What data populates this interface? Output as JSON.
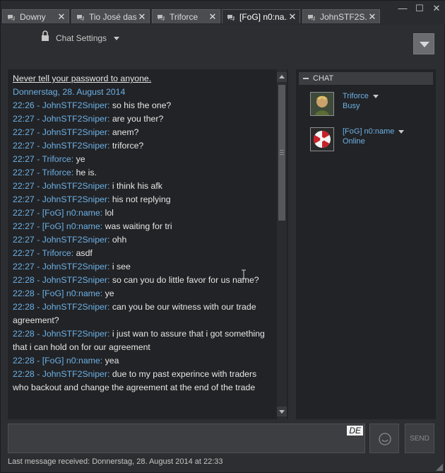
{
  "tabs": [
    {
      "label": "Downy",
      "active": false,
      "icon": "chat-bubbles-icon"
    },
    {
      "label": "Tio José das...",
      "active": false,
      "icon": "chat-bubbles-icon"
    },
    {
      "label": "Triforce",
      "active": false,
      "icon": "chat-bubbles-icon"
    },
    {
      "label": "[FoG] n0:na...",
      "active": true,
      "icon": "chat-bubbles-icon"
    },
    {
      "label": "JohnSTF2S...",
      "active": false,
      "icon": "chat-bubbles-icon"
    }
  ],
  "window_controls": {
    "minimize": "—",
    "maximize": "☐",
    "close": "✕"
  },
  "tab_close": "✕",
  "header": {
    "chat_settings_label": "Chat Settings"
  },
  "chat": {
    "warning": "Never tell your password to anyone.",
    "date": "Donnerstag, 28. August 2014",
    "messages": [
      {
        "time": "22:26",
        "name": "JohnSTF2Sniper",
        "text": "so his the one?"
      },
      {
        "time": "22:27",
        "name": "JohnSTF2Sniper",
        "text": "are you ther?"
      },
      {
        "time": "22:27",
        "name": "JohnSTF2Sniper",
        "text": "anem?"
      },
      {
        "time": "22:27",
        "name": "JohnSTF2Sniper",
        "text": "triforce?"
      },
      {
        "time": "22:27",
        "name": "Triforce",
        "text": "ye"
      },
      {
        "time": "22:27",
        "name": "Triforce",
        "text": "he is."
      },
      {
        "time": "22:27",
        "name": "JohnSTF2Sniper",
        "text": "i think his afk"
      },
      {
        "time": "22:27",
        "name": "JohnSTF2Sniper",
        "text": "his not replying"
      },
      {
        "time": "22:27",
        "name": "[FoG] n0:name",
        "text": "lol"
      },
      {
        "time": "22:27",
        "name": "[FoG] n0:name",
        "text": "was waiting for tri"
      },
      {
        "time": "22:27",
        "name": "JohnSTF2Sniper",
        "text": "ohh"
      },
      {
        "time": "22:27",
        "name": "Triforce",
        "text": "asdf"
      },
      {
        "time": "22:27",
        "name": "JohnSTF2Sniper",
        "text": "i see"
      },
      {
        "time": "22:28",
        "name": "JohnSTF2Sniper",
        "text": "so can you do little favor for us name?"
      },
      {
        "time": "22:28",
        "name": "[FoG] n0:name",
        "text": "ye"
      },
      {
        "time": "22:28",
        "name": "JohnSTF2Sniper",
        "text": "can you be our witness with our trade  agreement?"
      },
      {
        "time": "22:28",
        "name": "JohnSTF2Sniper",
        "text": "i just wan to assure that i got something that i can hold on for our agreement"
      },
      {
        "time": "22:28",
        "name": "[FoG] n0:name",
        "text": "yea"
      },
      {
        "time": "22:28",
        "name": "JohnSTF2Sniper",
        "text": "due to my past experince with traders who backout and change the agreement at the end of the trade"
      }
    ]
  },
  "members_panel": {
    "header": "CHAT",
    "members": [
      {
        "name": "Triforce",
        "status": "Busy"
      },
      {
        "name": "[FoG] n0:name",
        "status": "Online"
      }
    ]
  },
  "input": {
    "language_badge": "DE",
    "value": ""
  },
  "send_label": "SEND",
  "status_bar": "Last message received: Donnerstag, 28. August 2014 at 22:33",
  "colors": {
    "accent_blue": "#6cb1e6",
    "background": "#2d2e31",
    "panel": "#222326"
  }
}
